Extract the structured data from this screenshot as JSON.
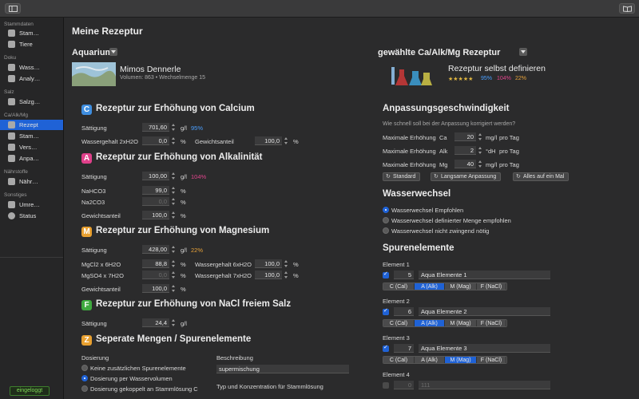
{
  "sidebar": {
    "sections": {
      "stammdaten": "Stammdaten",
      "doku": "Doku",
      "salz": "Salz",
      "caalkmg": "Ca/Alk/Mg",
      "naehrstoffe": "Nährstoffe",
      "sonstiges": "Sonstiges"
    },
    "items": {
      "stamm": "Stam…",
      "tiere": "Tiere",
      "wass": "Wass…",
      "analy": "Analy…",
      "salzg": "Salzg…",
      "rezept": "Rezept",
      "stamm2": "Stam…",
      "vers": "Vers…",
      "anpa": "Anpa…",
      "naehr": "Nähr…",
      "umre": "Umre…",
      "status": "Status"
    },
    "logged_in": "eingeloggt"
  },
  "main": {
    "title": "Meine Rezeptur",
    "aquarium": {
      "heading": "Aquarium",
      "name": "Mimos Dennerle",
      "info": "Volumen: 863 • Wechselmenge 15"
    },
    "recipe": {
      "heading": "gewählte Ca/Alk/Mg Rezeptur",
      "name": "Rezeptur selbst definieren",
      "stars": "★★★★★",
      "pct1": "95%",
      "pct2": "104%",
      "pct3": "22%"
    },
    "calcium": {
      "badge": "C",
      "title": "Rezeptur zur Erhöhung von Calcium",
      "saettigung_label": "Sättigung",
      "saettigung": "701,60",
      "unit": "g/l",
      "pct": "95%",
      "water_label": "Wassergehalt 2xH2O",
      "water": "0,0",
      "water_unit": "%",
      "gew_label": "Gewichtsanteil",
      "gew": "100,0",
      "gew_unit": "%"
    },
    "alk": {
      "badge": "A",
      "title": "Rezeptur zur Erhöhung von Alkalinität",
      "saettigung_label": "Sättigung",
      "saettigung": "100,00",
      "unit": "g/l",
      "pct": "104%",
      "nahco3_label": "NaHCO3",
      "nahco3": "99,0",
      "nahco3_unit": "%",
      "na2co3_label": "Na2CO3",
      "na2co3": "0,0",
      "na2co3_unit": "%",
      "gew_label": "Gewichtsanteil",
      "gew": "100,0",
      "gew_unit": "%"
    },
    "mg": {
      "badge": "M",
      "title": "Rezeptur zur Erhöhung von Magnesium",
      "saettigung_label": "Sättigung",
      "saettigung": "428,00",
      "unit": "g/l",
      "pct": "22%",
      "mgcl_label": "MgCl2 x 6H2O",
      "mgcl": "88,8",
      "mgcl_unit": "%",
      "mgcl_w_label": "Wassergehalt 6xH2O",
      "mgcl_w": "100,0",
      "mgcl_w_unit": "%",
      "mgso_label": "MgSO4 x 7H2O",
      "mgso": "0,0",
      "mgso_unit": "%",
      "mgso_w_label": "Wassergehalt 7xH2O",
      "mgso_w": "100,0",
      "mgso_w_unit": "%",
      "gew_label": "Gewichtsanteil",
      "gew": "100,0",
      "gew_unit": "%"
    },
    "nacl": {
      "badge": "F",
      "title": "Rezeptur zur Erhöhung von NaCl freiem Salz",
      "saettigung_label": "Sättigung",
      "saettigung": "24,4",
      "unit": "g/l"
    },
    "separate": {
      "badge": "Z",
      "title": "Seperate Mengen / Spurenelemente",
      "dosierung_label": "Dosierung",
      "opt1": "Keine zusätzlichen Spurenelemente",
      "opt2": "Dosierung per Wasservolumen",
      "opt3": "Dosierung gekoppelt an Stammlösung C",
      "beschreibung_label": "Beschreibung",
      "beschreibung": "supermischung",
      "typ_label": "Typ und Konzentration für Stammlösung"
    },
    "anpassung": {
      "title": "Anpassungsgeschwindigkeit",
      "question": "Wie schnell soll bei der Anpassung korrigiert werden?",
      "rows": [
        {
          "label": "Maximale Erhöhung",
          "el": "Ca",
          "val": "20",
          "unit": "mg/l",
          "per": "pro Tag"
        },
        {
          "label": "Maximale Erhöhung",
          "el": "Alk",
          "val": "2",
          "unit": "°dH",
          "per": "pro Tag"
        },
        {
          "label": "Maximale Erhöhung",
          "el": "Mg",
          "val": "40",
          "unit": "mg/l",
          "per": "pro Tag"
        }
      ],
      "btn1": "Standard",
      "btn2": "Langsame Anpassung",
      "btn3": "Alles auf ein Mal"
    },
    "wasserwechsel": {
      "title": "Wasserwechsel",
      "opt1": "Wasserwechsel Empfohlen",
      "opt2": "Wasserwechsel definierter Menge empfohlen",
      "opt3": "Wasserwechsel nicht zwingend nötig"
    },
    "spuren": {
      "title": "Spurenelemente",
      "seg": [
        "C (Cal)",
        "A (Alk)",
        "M (Mag)",
        "F (NaCl)"
      ],
      "elements": [
        {
          "label": "Element 1",
          "num": "5",
          "name": "Aqua Elemente 1"
        },
        {
          "label": "Element 2",
          "num": "6",
          "name": "Aqua Elemente 2"
        },
        {
          "label": "Element 3",
          "num": "7",
          "name": "Aqua Elemente 3"
        },
        {
          "label": "Element 4",
          "num": "0",
          "name": "111"
        }
      ]
    }
  }
}
